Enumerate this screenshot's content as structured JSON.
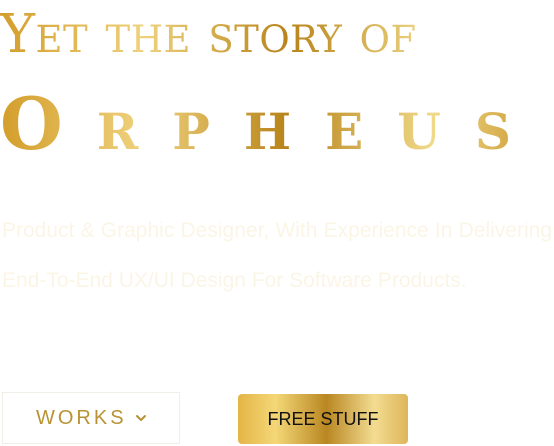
{
  "hero": {
    "title_line1": "Yet the story of",
    "title_line2": "Orpheus",
    "description": "Product & Graphic Designer, With Experience In Delivering End-To-End UX/UI Design For Software Products."
  },
  "actions": {
    "works_label": "WORKS",
    "free_stuff_label": "FREE STUFF"
  },
  "icons": {
    "works_dropdown": "chevron-down-icon"
  },
  "colors": {
    "gold_primary": "#d39d2b",
    "gold_light": "#f0d989",
    "gold_dark": "#b8831a",
    "works_text": "#b89235",
    "button_text": "#111111"
  }
}
